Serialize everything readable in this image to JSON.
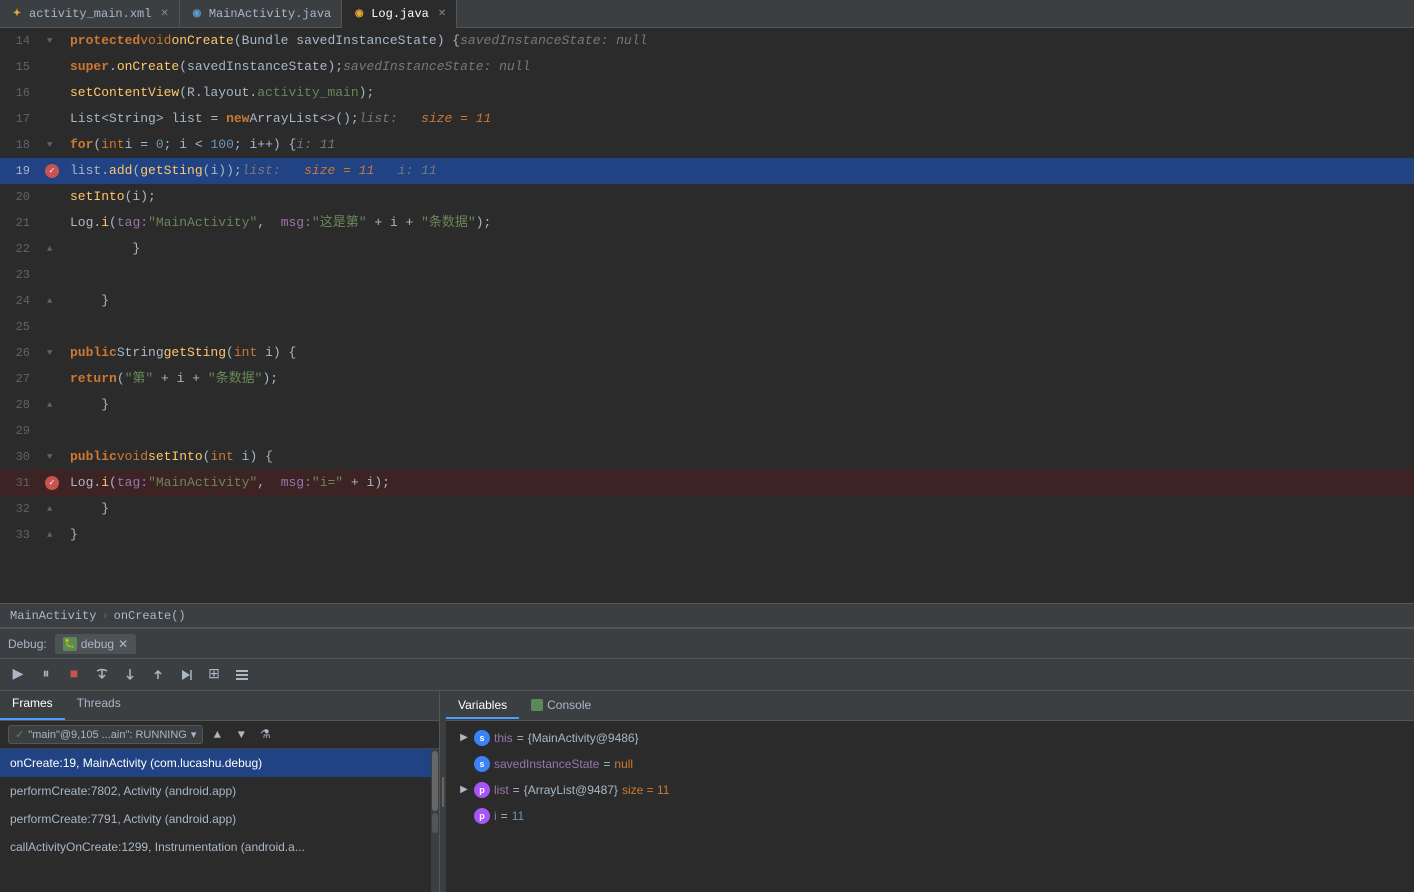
{
  "tabs": [
    {
      "id": "activity_main_xml",
      "label": "activity_main.xml",
      "type": "xml",
      "active": false
    },
    {
      "id": "mainactivity_java",
      "label": "MainActivity.java",
      "type": "java_blue",
      "active": false
    },
    {
      "id": "log_java",
      "label": "Log.java",
      "type": "java_orange",
      "active": true
    }
  ],
  "code": {
    "lines": [
      {
        "num": 14,
        "highlighted": false,
        "error": false,
        "breakpoint": false,
        "foldable": true
      },
      {
        "num": 15,
        "highlighted": false,
        "error": false,
        "breakpoint": false,
        "foldable": false
      },
      {
        "num": 16,
        "highlighted": false,
        "error": false,
        "breakpoint": false,
        "foldable": false
      },
      {
        "num": 17,
        "highlighted": false,
        "error": false,
        "breakpoint": false,
        "foldable": false
      },
      {
        "num": 18,
        "highlighted": false,
        "error": false,
        "breakpoint": false,
        "foldable": true
      },
      {
        "num": 19,
        "highlighted": true,
        "error": true,
        "breakpoint": true,
        "foldable": false
      },
      {
        "num": 20,
        "highlighted": false,
        "error": false,
        "breakpoint": false,
        "foldable": false
      },
      {
        "num": 21,
        "highlighted": false,
        "error": false,
        "breakpoint": false,
        "foldable": false
      },
      {
        "num": 22,
        "highlighted": false,
        "error": false,
        "breakpoint": false,
        "foldable": false
      },
      {
        "num": 23,
        "highlighted": false,
        "error": false,
        "breakpoint": false,
        "foldable": false
      },
      {
        "num": 24,
        "highlighted": false,
        "error": false,
        "breakpoint": false,
        "foldable": false
      },
      {
        "num": 25,
        "highlighted": false,
        "error": false,
        "breakpoint": false,
        "foldable": false
      },
      {
        "num": 26,
        "highlighted": false,
        "error": false,
        "breakpoint": false,
        "foldable": true
      },
      {
        "num": 27,
        "highlighted": false,
        "error": false,
        "breakpoint": false,
        "foldable": false
      },
      {
        "num": 28,
        "highlighted": false,
        "error": false,
        "breakpoint": false,
        "foldable": false
      },
      {
        "num": 29,
        "highlighted": false,
        "error": false,
        "breakpoint": false,
        "foldable": false
      },
      {
        "num": 30,
        "highlighted": false,
        "error": false,
        "breakpoint": false,
        "foldable": true
      },
      {
        "num": 31,
        "highlighted": false,
        "error": true,
        "breakpoint": true,
        "foldable": false
      },
      {
        "num": 32,
        "highlighted": false,
        "error": false,
        "breakpoint": false,
        "foldable": false
      },
      {
        "num": 33,
        "highlighted": false,
        "error": false,
        "breakpoint": false,
        "foldable": false
      }
    ]
  },
  "breadcrumb": {
    "class": "MainActivity",
    "method": "onCreate()",
    "separator": "›"
  },
  "debug": {
    "label": "Debug:",
    "tab_label": "debug",
    "toolbar_buttons": [
      {
        "id": "resume",
        "icon": "▶",
        "label": "Resume"
      },
      {
        "id": "step_over",
        "icon": "↓",
        "label": "Step Over"
      },
      {
        "id": "step_into",
        "icon": "↓↓",
        "label": "Step Into"
      },
      {
        "id": "step_out",
        "icon": "↑",
        "label": "Step Out"
      },
      {
        "id": "run_to_cursor",
        "icon": "→",
        "label": "Run to Cursor"
      },
      {
        "id": "evaluate",
        "icon": "⊞",
        "label": "Evaluate"
      },
      {
        "id": "trace",
        "icon": "≡",
        "label": "Trace"
      }
    ]
  },
  "frames": {
    "tab_label": "Frames",
    "threads_tab_label": "Threads",
    "thread_name": "\"main\"@9,105 ...ain\": RUNNING",
    "items": [
      {
        "id": 1,
        "text": "onCreate:19, MainActivity (com.lucashu.debug)",
        "active": true
      },
      {
        "id": 2,
        "text": "performCreate:7802, Activity (android.app)",
        "active": false
      },
      {
        "id": 3,
        "text": "performCreate:7791, Activity (android.app)",
        "active": false
      },
      {
        "id": 4,
        "text": "callActivityOnCreate:1299, Instrumentation (android.a...",
        "active": false
      }
    ]
  },
  "variables": {
    "tab_label": "Variables",
    "console_label": "Console",
    "items": [
      {
        "id": "this",
        "expand": true,
        "type": "s",
        "name": "this",
        "eq": " = ",
        "value": "{MainActivity@9486}"
      },
      {
        "id": "savedInstanceState",
        "expand": false,
        "type": "s",
        "name": "savedInstanceState",
        "eq": " = ",
        "value": "null",
        "null": true
      },
      {
        "id": "list",
        "expand": true,
        "type": "p",
        "name": "list",
        "eq": " = ",
        "value": "{ArrayList@9487}",
        "size": " size = 11"
      },
      {
        "id": "i",
        "expand": false,
        "type": "p",
        "name": "i",
        "eq": " = ",
        "value": "11",
        "num": true
      }
    ]
  }
}
